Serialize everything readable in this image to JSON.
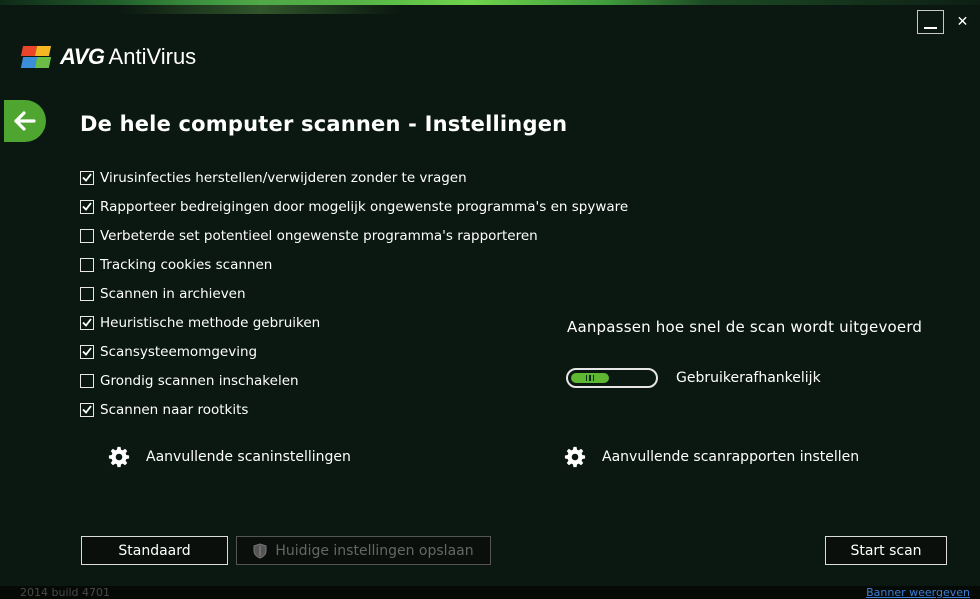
{
  "window": {
    "controls": {
      "minimize": "_",
      "close": "✕"
    }
  },
  "app": {
    "brand": "AVG",
    "product": "AntiVirus"
  },
  "page": {
    "title": "De hele computer scannen - Instellingen"
  },
  "options": [
    {
      "label": "Virusinfecties herstellen/verwijderen zonder te vragen",
      "checked": true
    },
    {
      "label": "Rapporteer bedreigingen door mogelijk ongewenste programma's en spyware",
      "checked": true
    },
    {
      "label": "Verbeterde set potentieel ongewenste programma's rapporteren",
      "checked": false
    },
    {
      "label": "Tracking cookies scannen",
      "checked": false
    },
    {
      "label": "Scannen in archieven",
      "checked": false
    },
    {
      "label": "Heuristische methode gebruiken",
      "checked": true
    },
    {
      "label": "Scansysteemomgeving",
      "checked": true
    },
    {
      "label": "Grondig scannen inschakelen",
      "checked": false
    },
    {
      "label": "Scannen naar rootkits",
      "checked": true
    }
  ],
  "links": {
    "extra_scan_settings": "Aanvullende scaninstellingen",
    "extra_scan_reports": "Aanvullende scanrapporten instellen"
  },
  "speed": {
    "title": "Aanpassen hoe snel de scan wordt uitgevoerd",
    "value_label": "Gebruikerafhankelijk",
    "level": 0.4
  },
  "buttons": {
    "standard": "Standaard",
    "save": "Huidige instellingen opslaan",
    "start": "Start scan"
  },
  "footer": {
    "build": "2014  build 4701",
    "banner": "Banner weergeven"
  },
  "colors": {
    "accent_green": "#4ea52f",
    "background": "#0b1811",
    "link_blue": "#3d7fd6"
  }
}
